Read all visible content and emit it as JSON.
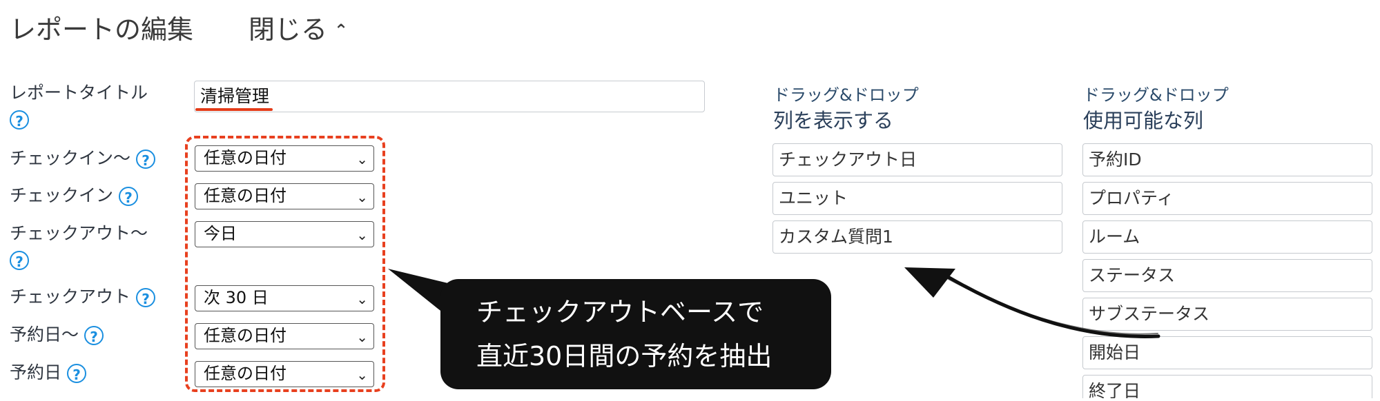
{
  "header": {
    "title": "レポートの編集",
    "close_label": "閉じる",
    "close_icon": "double-chevron-up-icon"
  },
  "form": {
    "report_title_label": "レポートタイトル",
    "report_title_value": "清掃管理",
    "help_glyph": "?",
    "fields": [
      {
        "label": "チェックイン〜",
        "value": "任意の日付"
      },
      {
        "label": "チェックイン",
        "value": "任意の日付"
      },
      {
        "label": "チェックアウト〜",
        "value": "今日"
      },
      {
        "label": "チェックアウト",
        "value": "次 30 日"
      },
      {
        "label": "予約日〜",
        "value": "任意の日付"
      },
      {
        "label": "予約日",
        "value": "任意の日付"
      }
    ]
  },
  "callout": {
    "line1": "チェックアウトベースで",
    "line2": "直近30日間の予約を抽出"
  },
  "display_columns": {
    "hint": "ドラッグ&ドロップ",
    "title": "列を表示する",
    "items": [
      "チェックアウト日",
      "ユニット",
      "カスタム質問1"
    ]
  },
  "available_columns": {
    "hint": "ドラッグ&ドロップ",
    "title": "使用可能な列",
    "items": [
      "予約ID",
      "プロパティ",
      "ルーム",
      "ステータス",
      "サブステータス",
      "開始日",
      "終了日"
    ]
  },
  "colors": {
    "accent_blue": "#1a8fe0",
    "annotation_red": "#e8401f",
    "callout_bg": "#111111"
  }
}
